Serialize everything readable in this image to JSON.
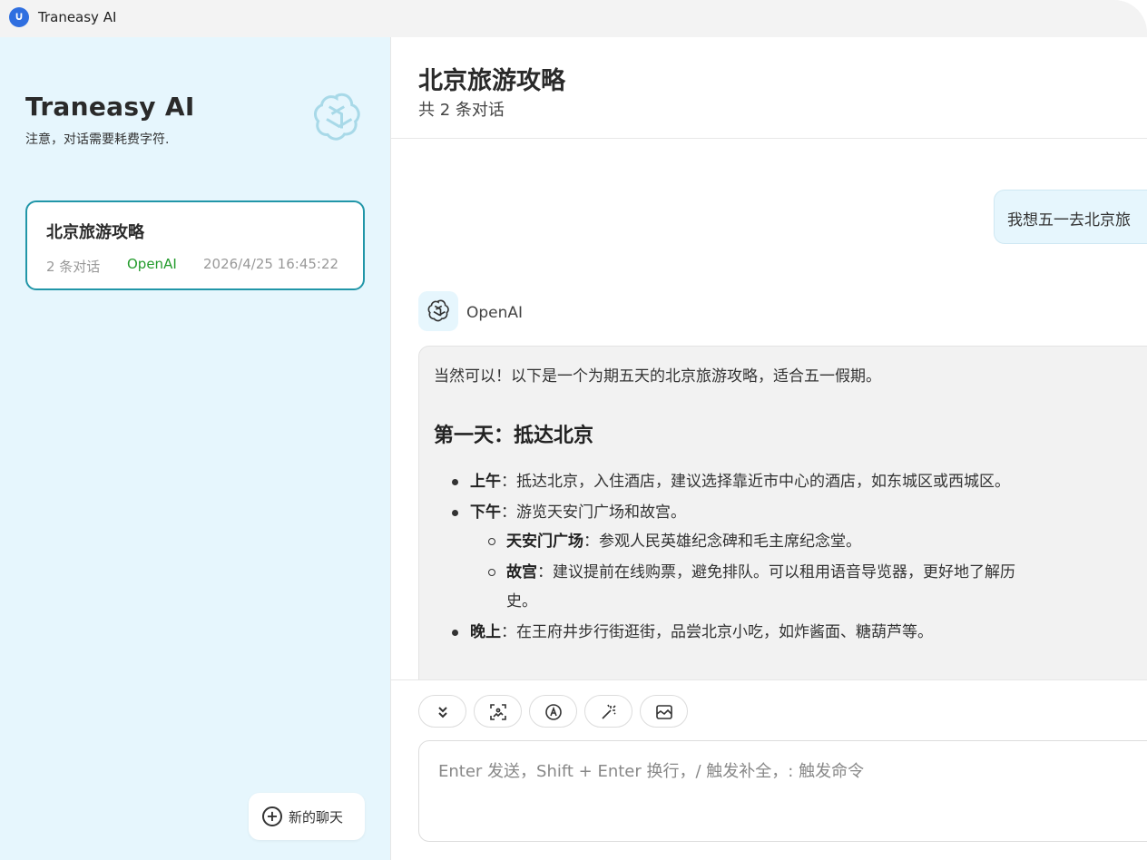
{
  "window": {
    "app_title": "Traneasy AI"
  },
  "sidebar": {
    "brand_title": "Traneasy AI",
    "brand_subtitle": "注意，对话需要耗费字符.",
    "conversations": [
      {
        "title": "北京旅游攻略",
        "count_label": "2 条对话",
        "model": "OpenAI",
        "timestamp": "2026/4/25 16:45:22"
      }
    ],
    "new_chat_label": "新的聊天"
  },
  "chat": {
    "title": "北京旅游攻略",
    "subtitle": "共 2 条对话",
    "user_message": "我想五一去北京旅",
    "bot_name": "OpenAI",
    "bot_message": {
      "intro": "当然可以！以下是一个为期五天的北京旅游攻略，适合五一假期。",
      "day1_heading": "第一天：抵达北京",
      "items": [
        {
          "label": "上午",
          "text": "：抵达北京，入住酒店，建议选择靠近市中心的酒店，如东城区或西城区。"
        },
        {
          "label": "下午",
          "text": "：游览天安门广场和故宫。"
        },
        {
          "label": "天安门广场",
          "text": "：参观人民英雄纪念碑和毛主席纪念堂。"
        },
        {
          "label": "故宫",
          "text": "：建议提前在线购票，避免排队。可以租用语音导览器，更好地了解历",
          "text2": "史。"
        },
        {
          "label": "晚上",
          "text": "：在王府井步行街逛街，品尝北京小吃，如炸酱面、糖葫芦等。"
        }
      ]
    }
  },
  "composer": {
    "tools": [
      "chevrons-down-icon",
      "image-scan-icon",
      "translate-icon",
      "magic-wand-icon",
      "image-icon"
    ],
    "placeholder": "Enter 发送，Shift + Enter 换行，/ 触发补全，: 触发命令"
  },
  "colors": {
    "sidebar_bg": "#e6f6fd",
    "accent_border": "#2196a8",
    "model_green": "#239b2c",
    "app_icon_blue": "#2f6fe0"
  }
}
